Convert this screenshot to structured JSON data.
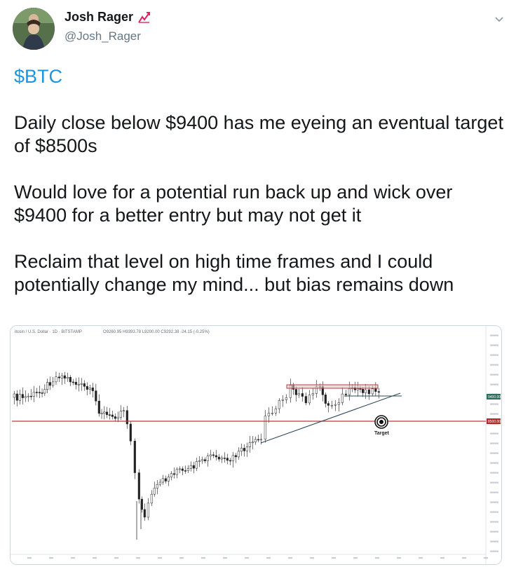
{
  "author": {
    "display_name": "Josh Rager",
    "handle": "@Josh_Rager",
    "badge_icon": "chart-trend-icon"
  },
  "tweet": {
    "cashtag": "$BTC",
    "paragraphs": [
      "Daily close below $9400 has me eyeing an eventual target of $8500s",
      "Would love for a potential run back up and wick over $9400 for a better entry but may not get it",
      "Reclaim that level on high time frames and I could potentially change my mind... but bias remains down"
    ]
  },
  "menu": {
    "icon": "chevron-down-icon"
  },
  "chart": {
    "header": "itcoin / U.S. Dollar · 1D · BITSTAMP",
    "ohlc": "O9260.95 H9393.78 L9200.00 C9292.38 -24.15 (-0.25%)",
    "price_labels": [
      "9400.00",
      "8500.00"
    ],
    "target_label": "Target",
    "colors": {
      "support_line": "#c0383f",
      "resistance_box": "#b04148",
      "trendline": "#2d4a5a",
      "price_tag": "#b12a2a"
    }
  }
}
